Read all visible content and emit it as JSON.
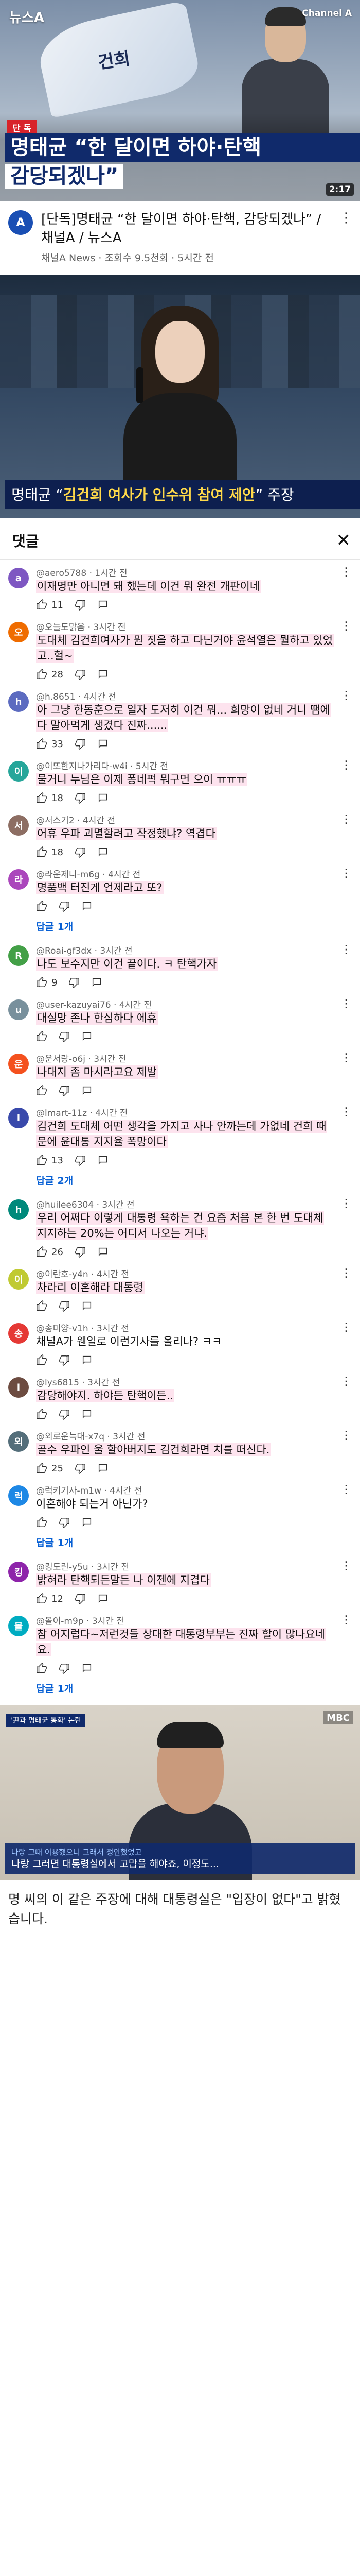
{
  "hero": {
    "logo": "뉴스A",
    "channel_mark": "Channel A",
    "flag_text": "건희",
    "tag": "단 독",
    "headline_line1": "명태균 “한 달이면 하야·탄핵",
    "headline_line2": "감당되겠나”",
    "duration": "2:17"
  },
  "video_info": {
    "channel_avatar_letter": "A",
    "title": "[단독]명태균 “한 달이면 하야·탄핵, 감당되겠나” / 채널A / 뉴스A",
    "meta": "채널A News · 조회수 9.5천회 · 5시간 전"
  },
  "frame2": {
    "subtitle_prefix": "명태균 “",
    "subtitle_highlight": "김건희 여사가 인수위 참여 제안",
    "subtitle_suffix": "” 주장"
  },
  "panel": {
    "title": "댓글",
    "close_glyph": "✕"
  },
  "comments": [
    {
      "user": "@aero5788",
      "time": "1시간 전",
      "text": "이재명만 아니면 돼 했는데 이건 뭐 완전 개판이네",
      "likes": "11",
      "replies": "",
      "color": "#7e57c2",
      "initial": "a",
      "highlight": true
    },
    {
      "user": "@오늘도맑음",
      "time": "3시간 전",
      "text": "도대체 김건희여사가 뭔 짓을 하고 다닌거야 윤석열은 뭘하고 있었고..헐~",
      "likes": "28",
      "replies": "",
      "color": "#ef6c00",
      "initial": "오",
      "highlight": true
    },
    {
      "user": "@h.8651",
      "time": "4시간 전",
      "text": "아 그냥 한동훈으로 일자 도저히 이건 뭐... 희망이 없네 거니 땜에 다 말아먹게 생겼다 진짜......",
      "likes": "33",
      "replies": "",
      "color": "#5c6bc0",
      "initial": "h",
      "highlight": true
    },
    {
      "user": "@이또한지나가리다-w4i",
      "time": "5시간 전",
      "text": "물거니 누님은 이제 퐁네퍽 뭐구먼 으이 ㅠㅠㅠ",
      "likes": "18",
      "replies": "",
      "color": "#26a69a",
      "initial": "이",
      "highlight": true
    },
    {
      "user": "@서스기2",
      "time": "4시간 전",
      "text": "어휴 우파 괴멸할려고 작정했냐? 역겹다",
      "likes": "18",
      "replies": "",
      "color": "#8d6e63",
      "initial": "서",
      "highlight": true
    },
    {
      "user": "@라운제니-m6g",
      "time": "4시간 전",
      "text": "명품백 터진게 언제라고 또?",
      "likes": "",
      "replies": "답글 1개",
      "color": "#ab47bc",
      "initial": "라",
      "highlight": true
    },
    {
      "user": "@Roai-gf3dx",
      "time": "3시간 전",
      "text": "나도 보수지만 이건 끝이다. ㅋ 탄핵가자",
      "likes": "9",
      "replies": "",
      "color": "#43a047",
      "initial": "R",
      "highlight": true
    },
    {
      "user": "@user-kazuyai76",
      "time": "4시간 전",
      "text": "대실망 존나 한심하다 에휴",
      "likes": "",
      "replies": "",
      "color": "#78909c",
      "initial": "u",
      "highlight": true
    },
    {
      "user": "@운서랑-o6j",
      "time": "3시간 전",
      "text": "나대지 좀 마시라고요 제발",
      "likes": "",
      "replies": "",
      "color": "#f4511e",
      "initial": "운",
      "highlight": true
    },
    {
      "user": "@lmart-11z",
      "time": "4시간 전",
      "text": "김건희 도대체 어떤 생각을 가지고 사나 안까는데 가없네 건희 때문에 윤대통 지지율 폭망이다",
      "likes": "13",
      "replies": "답글 2개",
      "color": "#3949ab",
      "initial": "l",
      "highlight": true
    },
    {
      "user": "@huilee6304",
      "time": "3시간 전",
      "text": "우리 어쩌다 이렇게 대통령 욕하는 건 요즘 처음 본 한 번 도대체 지지하는 20%는 어디서 나오는 거냐.",
      "likes": "26",
      "replies": "",
      "color": "#00897b",
      "initial": "h",
      "highlight": true
    },
    {
      "user": "@이란호-y4n",
      "time": "4시간 전",
      "text": "차라리 이혼해라 대통령",
      "likes": "",
      "replies": "",
      "color": "#c0ca33",
      "initial": "이",
      "highlight": true
    },
    {
      "user": "@송미양-v1h",
      "time": "3시간 전",
      "text": "채널A가 웬일로 이런기사를 올리나? ㅋㅋ",
      "likes": "",
      "replies": "",
      "color": "#e53935",
      "initial": "송",
      "highlight": false
    },
    {
      "user": "@lys6815",
      "time": "3시간 전",
      "text": "감당해야지. 하야든 탄핵이든..",
      "likes": "",
      "replies": "",
      "color": "#6d4c41",
      "initial": "l",
      "highlight": true
    },
    {
      "user": "@외로운늑대-x7q",
      "time": "3시간 전",
      "text": "골수 우파인 울 할아버지도 김건희라면 치를 떠신다.",
      "likes": "25",
      "replies": "",
      "color": "#546e7a",
      "initial": "외",
      "highlight": true
    },
    {
      "user": "@럭키기사-m1w",
      "time": "4시간 전",
      "text": "이혼해야 되는거 아닌가?",
      "likes": "",
      "replies": "답글 1개",
      "color": "#1e88e5",
      "initial": "럭",
      "highlight": false
    },
    {
      "user": "@킹도린-y5u",
      "time": "3시간 전",
      "text": "밝혀라 탄핵되든말든 나 이젠에 지겹다",
      "likes": "12",
      "replies": "",
      "color": "#8e24aa",
      "initial": "킹",
      "highlight": true
    },
    {
      "user": "@몰이-m9p",
      "time": "3시간 전",
      "text": "참 어지럽다~저런것들 상대한 대통령부부는 진짜 할이 많나요네요.",
      "likes": "",
      "replies": "답글 1개",
      "color": "#00acc1",
      "initial": "몰",
      "highlight": true
    }
  ],
  "frame3": {
    "corner_label": "'尹과 명태균 통화' 논란",
    "broadcaster": "MBC",
    "lower_line1": "나랑 그때 이용했으니 그래서 정안했었고",
    "lower_line2": "나랑 그러면 대통령실에서 고맙을 해야죠, 이정도..."
  },
  "article": {
    "text": "명 씨의 이 같은 주장에 대해 대통령실은 \"입장이 없다\"고 밝혔습니다."
  }
}
